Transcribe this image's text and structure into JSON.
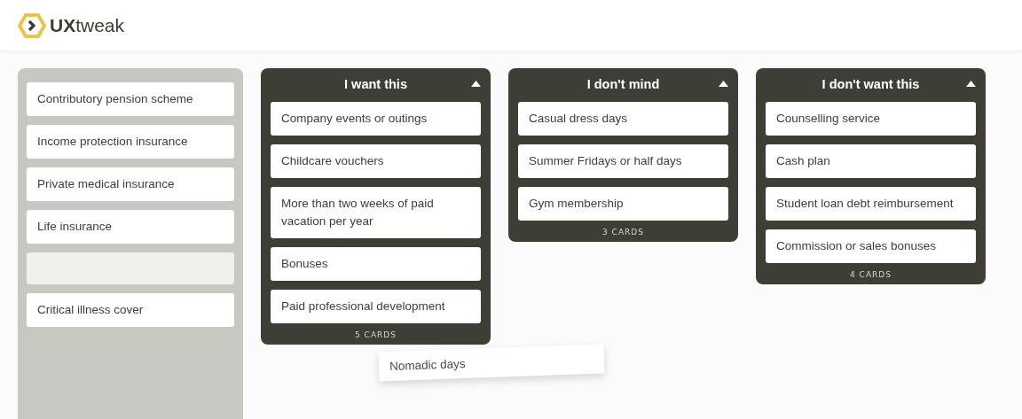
{
  "logo": {
    "text": "**UX**tweak"
  },
  "unsorted": [
    {
      "kind": "card",
      "label": "Contributory pension scheme"
    },
    {
      "kind": "card",
      "label": "Income protection insurance"
    },
    {
      "kind": "card",
      "label": "Private medical insurance"
    },
    {
      "kind": "card",
      "label": "Life insurance"
    },
    {
      "kind": "drop_slot"
    },
    {
      "kind": "card",
      "label": "Critical illness cover"
    }
  ],
  "groups": [
    {
      "title": "I want this",
      "expanded": true,
      "cards": [
        "Company events or outings",
        "Childcare vouchers",
        "More than two weeks of paid vacation per year",
        "Bonuses",
        "Paid professional development"
      ],
      "count": "5 CARDS"
    },
    {
      "title": "I don't mind",
      "expanded": true,
      "cards": [
        "Casual dress days",
        "Summer Fridays or half days",
        "Gym membership"
      ],
      "count": "3 CARDS"
    },
    {
      "title": "I don't want this",
      "expanded": true,
      "cards": [
        "Counselling service",
        "Cash plan",
        "Student loan debt reimbursement",
        "Commission or sales bonuses"
      ],
      "count": "4 CARDS"
    }
  ],
  "dragged_card": {
    "label": "Nomadic days"
  }
}
